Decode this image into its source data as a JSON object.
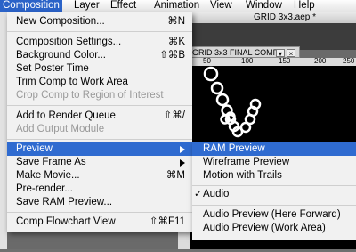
{
  "menubar": {
    "items": [
      "Composition",
      "Layer",
      "Effect",
      "Animation",
      "View",
      "Window",
      "Help"
    ]
  },
  "document": {
    "title": "GRID 3x3.aep *"
  },
  "comp_panel": {
    "tab_label": "GRID 3x3 FINAL COMP",
    "tab_button": "▾",
    "tab_close": "×",
    "ruler_labels": [
      "50",
      "100",
      "150",
      "200",
      "250"
    ]
  },
  "menu": {
    "new_composition": {
      "label": "New Composition...",
      "shortcut": "⌘N"
    },
    "composition_settings": {
      "label": "Composition Settings...",
      "shortcut": "⌘K"
    },
    "background_color": {
      "label": "Background Color...",
      "shortcut": "⇧⌘B"
    },
    "set_poster_time": {
      "label": "Set Poster Time"
    },
    "trim_comp": {
      "label": "Trim Comp to Work Area"
    },
    "crop_comp": {
      "label": "Crop Comp to Region of Interest"
    },
    "add_render_queue": {
      "label": "Add to Render Queue",
      "shortcut": "⇧⌘/"
    },
    "add_output_module": {
      "label": "Add Output Module"
    },
    "preview": {
      "label": "Preview"
    },
    "save_frame_as": {
      "label": "Save Frame As"
    },
    "make_movie": {
      "label": "Make Movie...",
      "shortcut": "⌘M"
    },
    "pre_render": {
      "label": "Pre-render..."
    },
    "save_ram_preview": {
      "label": "Save RAM Preview..."
    },
    "comp_flowchart": {
      "label": "Comp Flowchart View",
      "shortcut": "⇧⌘F11"
    }
  },
  "submenu": {
    "ram_preview": "RAM Preview",
    "wireframe_preview": "Wireframe Preview",
    "motion_with_trails": "Motion with Trails",
    "audio": "Audio",
    "audio_check": "✓",
    "audio_preview_here": "Audio Preview (Here Forward)",
    "audio_preview_work": "Audio Preview (Work Area)"
  }
}
